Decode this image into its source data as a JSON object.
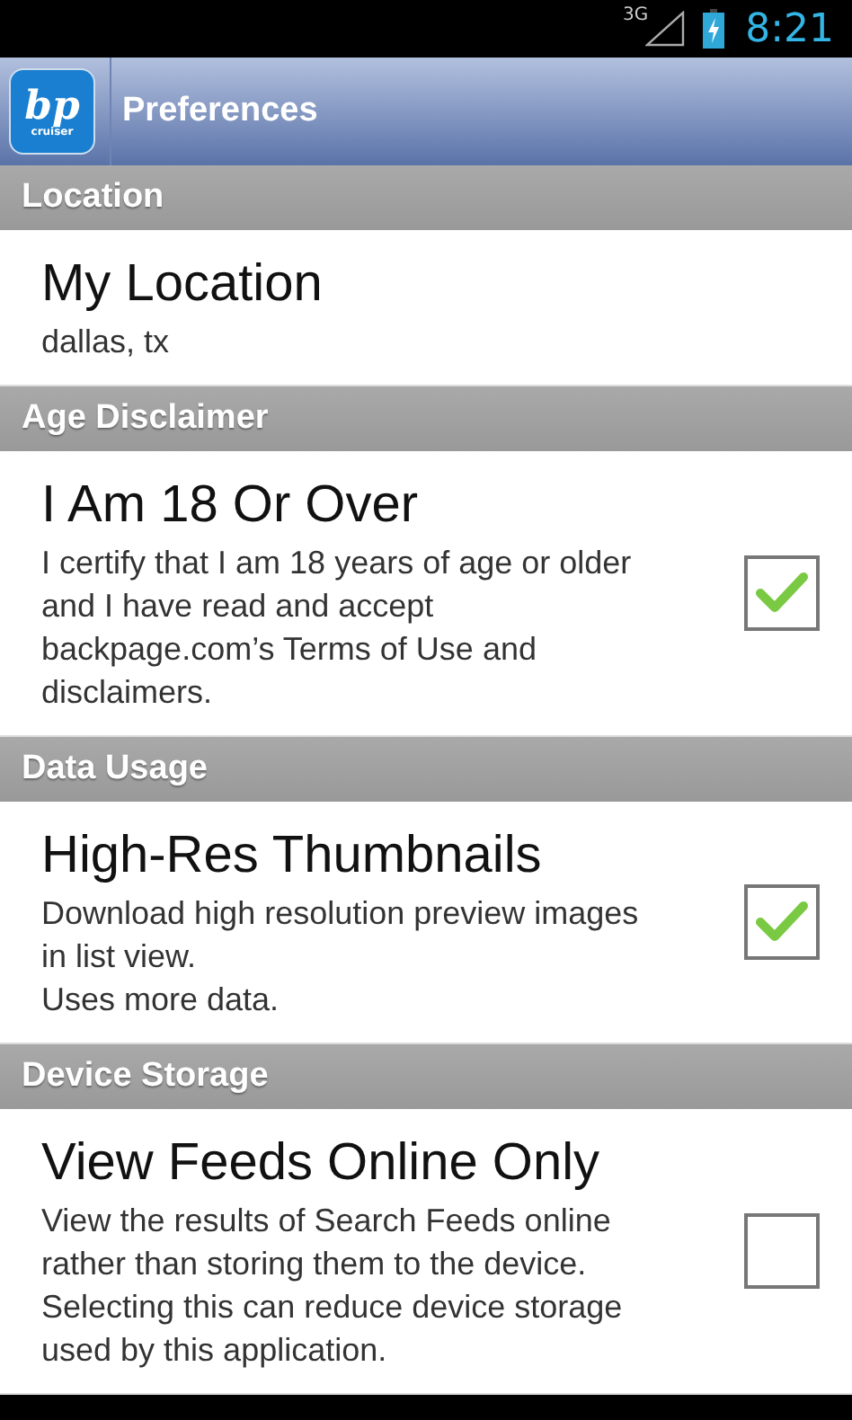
{
  "status_bar": {
    "network": "3G",
    "time": "8:21"
  },
  "action_bar": {
    "logo_text": "bp",
    "logo_subtext": "cruiser",
    "title": "Preferences"
  },
  "sections": [
    {
      "header": "Location",
      "items": [
        {
          "kind": "text",
          "title": "My Location",
          "summary": "dallas, tx"
        }
      ]
    },
    {
      "header": "Age Disclaimer",
      "items": [
        {
          "kind": "checkbox",
          "title": "I Am 18 Or Over",
          "summary": "I certify that I am 18 years of age or older and I have read and accept backpage.com’s Terms of Use and disclaimers.",
          "checked": true
        }
      ]
    },
    {
      "header": "Data Usage",
      "items": [
        {
          "kind": "checkbox",
          "title": "High-Res Thumbnails",
          "summary": "Download high resolution preview images in list view.\nUses more data.",
          "checked": true
        }
      ]
    },
    {
      "header": "Device Storage",
      "items": [
        {
          "kind": "checkbox",
          "title": "View Feeds Online Only",
          "summary": "View the results of Search Feeds online rather than storing them to the device. Selecting this can reduce device storage used by this application.",
          "checked": false
        }
      ]
    }
  ]
}
